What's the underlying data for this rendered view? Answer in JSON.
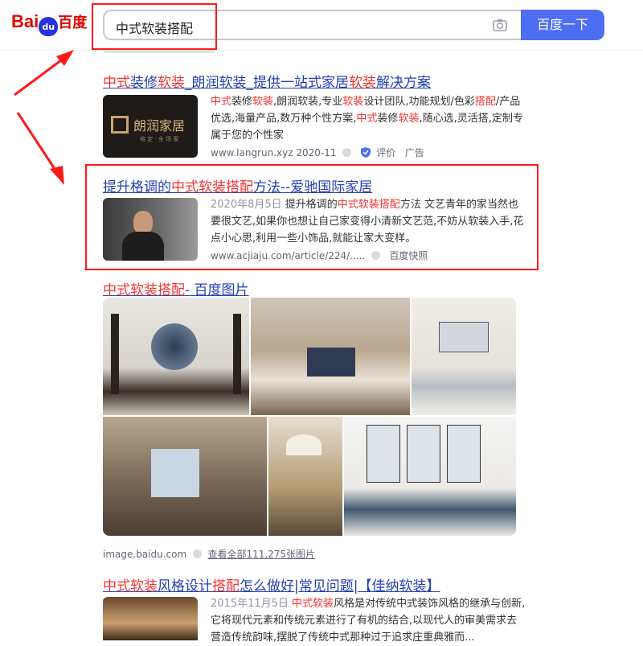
{
  "header": {
    "logo_bai": "Bai",
    "logo_du": "du",
    "logo_cn": "百度",
    "query": "中式软装搭配",
    "search_button": "百度一下"
  },
  "results": [
    {
      "title_parts": [
        "中式",
        "装修",
        "软装",
        "_朗润软装_提供一站式家居",
        "软装",
        "解决方案"
      ],
      "logo_text": "朗润家居",
      "logo_sub": "格 定 · 全 场 家",
      "snippet_parts": [
        "中式",
        "装修",
        "软装",
        ",朗润软装,专业",
        "软装",
        "设计团队,功能规划/色彩",
        "搭配",
        "/产品优选,海量产品,数万种个性方案,",
        "中式",
        "装修",
        "软装",
        ",随心选,灵活搭,定制专属于您的个性家"
      ],
      "url": "www.langrun.xyz",
      "date": "2020-11",
      "review": "评价",
      "ad": "广告"
    },
    {
      "title_parts": [
        "提升格调的",
        "中式软装搭配",
        "方法--爱驰国际家居"
      ],
      "date": "2020年8月5日",
      "snippet_parts": [
        "提升格调的",
        "中式软装搭配",
        "方法 文艺青年的家当然也要很文艺,如果你也想让自己家变得小清新文艺范,不妨从软装入手,花点小心思,利用一些小饰品,就能让家大变样。"
      ],
      "url": "www.acjiaju.com/article/224/.....",
      "cache": "百度快照"
    },
    {
      "title_parts": [
        "中式软装搭配",
        "- 百度图片"
      ],
      "source": "image.baidu.com",
      "view_all": "查看全部111,275张图片"
    },
    {
      "title_parts": [
        "中式",
        "软装",
        "风格设计",
        "搭配",
        "怎么做好|常见问题|【佳纳软装】"
      ],
      "date": "2015年11月5日",
      "snippet_parts": [
        "中式软装",
        "风格是对传统中式装饰风格的继承与创新,它将现代元素和传统元素进行了有机的结合,以现代人的审美需求去营造传统韵味,摆脱了传统中式那种过于追求庄重典雅而..."
      ]
    }
  ],
  "colors": {
    "link": "#2440b3",
    "highlight": "#f73131",
    "brand_red": "#e10601",
    "button": "#4e6ef2",
    "annotation": "#ff1a1a"
  },
  "icons": [
    "camera-icon",
    "verified-shield-icon",
    "arrow-annotation-icon"
  ]
}
